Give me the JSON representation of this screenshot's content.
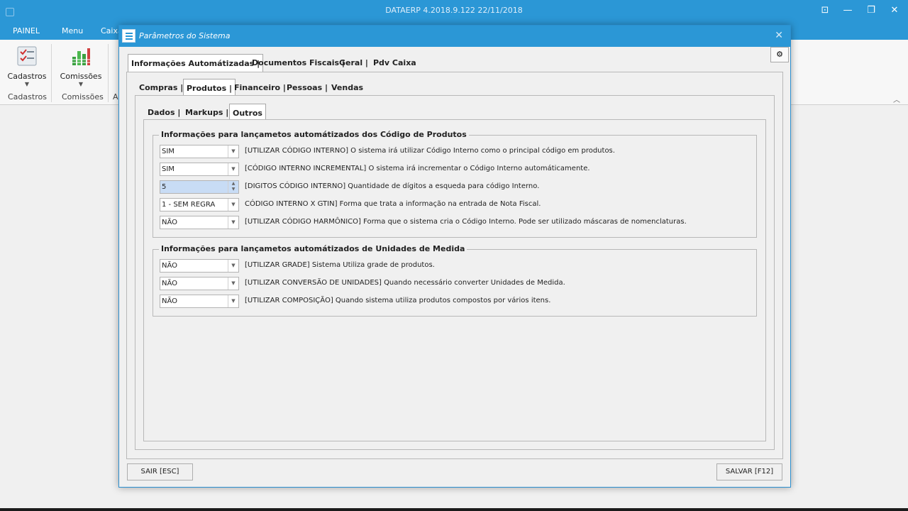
{
  "app": {
    "title": "DATAERP 4.2018.9.122 22/11/2018"
  },
  "ribbon": {
    "tabs": [
      "PAINEL",
      "Menu",
      "Caixa"
    ],
    "buttons": [
      {
        "label": "Cadastros",
        "icon": "checklist-icon"
      },
      {
        "label": "Comissões",
        "icon": "bar-chart-icon"
      }
    ],
    "groups": [
      "Cadastros",
      "Comissões",
      "A"
    ]
  },
  "dialog": {
    "title": "Parâmetros do Sistema",
    "close": "✕",
    "tabs_l1": [
      "Informações Automátizadas |",
      "Documentos Fiscais |",
      "Geral |",
      "Pdv Caixa"
    ],
    "tabs_l2": [
      "Compras |",
      "Produtos |",
      "Financeiro |",
      "Pessoas |",
      "Vendas"
    ],
    "tabs_l3": [
      "Dados |",
      "Markups |",
      "Outros"
    ],
    "group1": {
      "title": "Informações para lançametos automátizados dos Código de Produtos",
      "rows": [
        {
          "value": "SIM",
          "desc": "[UTILIZAR CÓDIGO INTERNO] O sistema irá utilizar Código Interno como o principal código em produtos."
        },
        {
          "value": "SIM",
          "desc": "[CÓDIGO INTERNO INCREMENTAL] O sistema irá incrementar o Código Interno automáticamente."
        },
        {
          "value": "5",
          "desc": "[DIGITOS CÓDIGO INTERNO] Quantidade de dígitos a esqueda para código Interno."
        },
        {
          "value": "1 - SEM REGRA",
          "desc": "CÓDIGO INTERNO X GTIN] Forma que trata a informação na entrada de Nota Fiscal."
        },
        {
          "value": "NÃO",
          "desc": "[UTILIZAR CÓDIGO HARMÔNICO] Forma que o sistema cria o Código Interno. Pode ser utilizado máscaras de nomenclaturas."
        }
      ]
    },
    "group2": {
      "title": "Informações para lançametos  automátizados de Unidades de Medida",
      "rows": [
        {
          "value": "NÃO",
          "desc": "[UTILIZAR GRADE] Sistema Utiliza grade de produtos."
        },
        {
          "value": "NÃO",
          "desc": "[UTILIZAR CONVERSÃO DE UNIDADES] Quando necessário converter Unidades de Medida."
        },
        {
          "value": "NÃO",
          "desc": "[UTILIZAR COMPOSIÇÃO] Quando sistema utiliza produtos compostos por vários itens."
        }
      ]
    },
    "buttons": {
      "exit": "SAIR [ESC]",
      "save": "SALVAR [F12]"
    }
  }
}
